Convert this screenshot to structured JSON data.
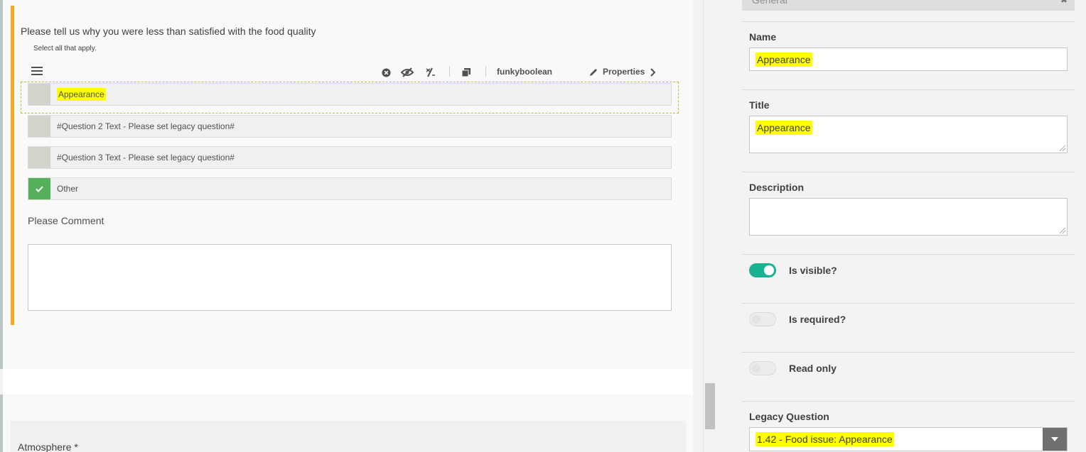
{
  "question": {
    "title": "Please tell us why you were less than satisfied with the food quality",
    "description": "Select all that apply.",
    "toolbar": {
      "type_label": "funkyboolean",
      "properties_label": "Properties"
    },
    "choices": [
      {
        "label": "Appearance",
        "checked": false
      },
      {
        "label": "#Question 2 Text - Please set legacy question#",
        "checked": false
      },
      {
        "label": "#Question 3 Text - Please set legacy question#",
        "checked": false
      },
      {
        "label": "Other",
        "checked": true
      }
    ],
    "comment_label": "Please Comment",
    "comment_value": ""
  },
  "next_question": {
    "title": "Atmosphere *"
  },
  "panel": {
    "section_title": "General",
    "name_label": "Name",
    "name_value": "Appearance",
    "title_label": "Title",
    "title_value": "Appearance",
    "description_label": "Description",
    "description_value": "",
    "is_visible_label": "Is visible?",
    "is_visible": true,
    "is_required_label": "Is required?",
    "is_required": false,
    "read_only_label": "Read only",
    "read_only": false,
    "legacy_label": "Legacy Question",
    "legacy_value": "1.42 - Food issue: Appearance"
  },
  "colors": {
    "accent_orange": "#f5a623",
    "toggle_on": "#19b394",
    "check_green": "#55b159",
    "highlight": "#ffff00",
    "selection_dash": "#a6c93e"
  }
}
